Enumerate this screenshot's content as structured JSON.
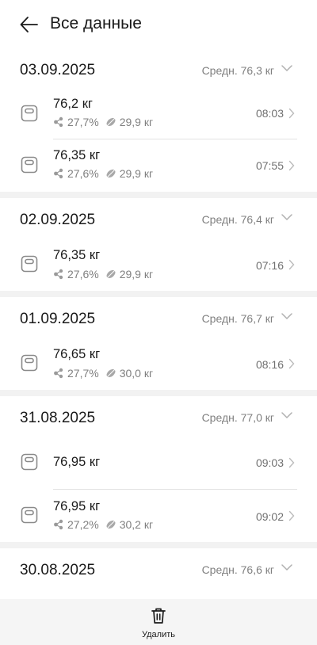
{
  "header": {
    "title": "Все данные",
    "back_icon": "arrow-left-icon"
  },
  "groups": [
    {
      "date": "03.09.2025",
      "avg": "Средн. 76,3 кг",
      "entries": [
        {
          "weight": "76,2  кг",
          "fat": "27,7%",
          "muscle": "29,9  кг",
          "time": "08:03"
        },
        {
          "weight": "76,35  кг",
          "fat": "27,6%",
          "muscle": "29,9  кг",
          "time": "07:55"
        }
      ]
    },
    {
      "date": "02.09.2025",
      "avg": "Средн. 76,4 кг",
      "entries": [
        {
          "weight": "76,35  кг",
          "fat": "27,6%",
          "muscle": "29,9  кг",
          "time": "07:16"
        }
      ]
    },
    {
      "date": "01.09.2025",
      "avg": "Средн. 76,7 кг",
      "entries": [
        {
          "weight": "76,65  кг",
          "fat": "27,7%",
          "muscle": "30,0  кг",
          "time": "08:16"
        }
      ]
    },
    {
      "date": "31.08.2025",
      "avg": "Средн. 77,0 кг",
      "entries": [
        {
          "weight": "76,95  кг",
          "time": "09:03"
        },
        {
          "weight": "76,95  кг",
          "fat": "27,2%",
          "muscle": "30,2  кг",
          "time": "09:02"
        }
      ]
    },
    {
      "date": "30.08.2025",
      "avg": "Средн. 76,6 кг"
    }
  ],
  "bottom": {
    "delete_label": "Удалить",
    "delete_icon": "trash-icon"
  }
}
